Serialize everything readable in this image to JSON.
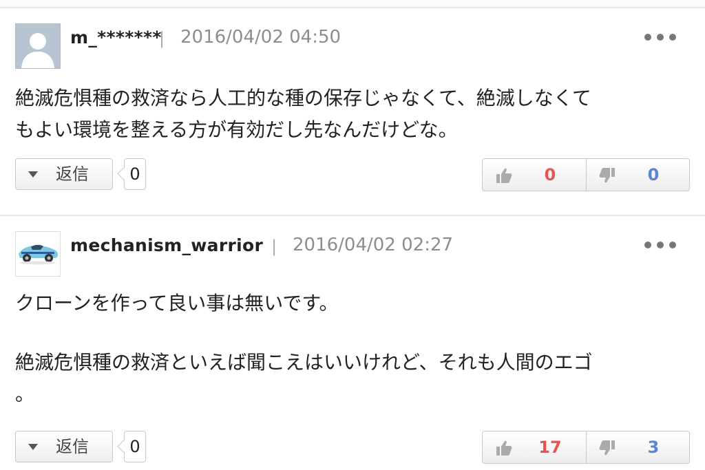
{
  "comments": [
    {
      "username": "m_*******",
      "separator": "|",
      "timestamp": "2016/04/02 04:50",
      "avatar": "default-user-silhouette",
      "body": [
        "絶滅危惧種の救済なら人工的な種の保存じゃなくて、絶滅しなくて",
        "もよい環境を整える方が有効だし先なんだけどな。"
      ],
      "reply_label": "返信",
      "reply_count": "0",
      "likes": "0",
      "dislikes": "0"
    },
    {
      "username": "mechanism_warrior",
      "separator": "|",
      "timestamp": "2016/04/02 02:27",
      "avatar": "race-car-photo",
      "body": [
        "クローンを作って良い事は無いです。",
        "",
        "絶滅危惧種の救済といえば聞こえはいいけれど、それも人間のエゴ",
        "。"
      ],
      "reply_label": "返信",
      "reply_count": "0",
      "likes": "17",
      "dislikes": "3"
    }
  ],
  "icons": {
    "more": "more-dots-icon",
    "reply_caret": "caret-down-icon",
    "like": "thumbs-up-icon",
    "dislike": "thumbs-down-icon"
  },
  "colors": {
    "like": "#e8554e",
    "dislike": "#5b84d6",
    "timestamp": "#8d8d8d",
    "divider": "#e6e6e6"
  }
}
